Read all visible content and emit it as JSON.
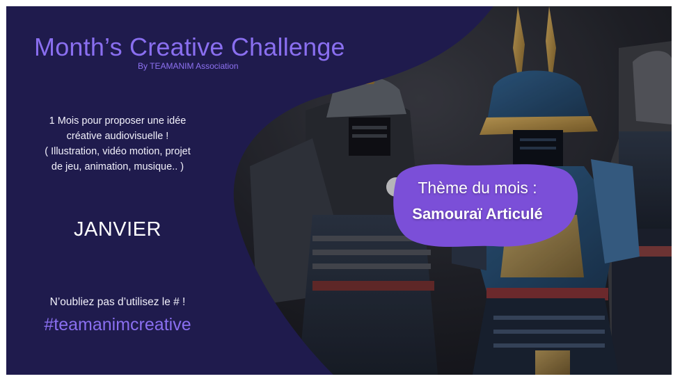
{
  "header": {
    "title": "Month’s Creative Challenge",
    "subtitle": "By TEAMANIM Association"
  },
  "intro": {
    "line1": "1 Mois pour proposer une idée",
    "line2": "créative audiovisuelle !",
    "line3": "( Illustration, vidéo motion, projet",
    "line4": "de jeu, animation, musique.. )"
  },
  "month": "JANVIER",
  "reminder": "N’oubliez pas d’utilisez le # !",
  "hashtag": "#teamanimcreative",
  "theme": {
    "label": "Thème du mois :",
    "value": "Samouraï Articulé"
  },
  "colors": {
    "background": "#1f1b4d",
    "accent": "#8a6ff0",
    "badge": "#7b4fd8",
    "text": "#ffffff"
  },
  "image": {
    "subject": "samurai-warriors-in-armor-photo"
  }
}
